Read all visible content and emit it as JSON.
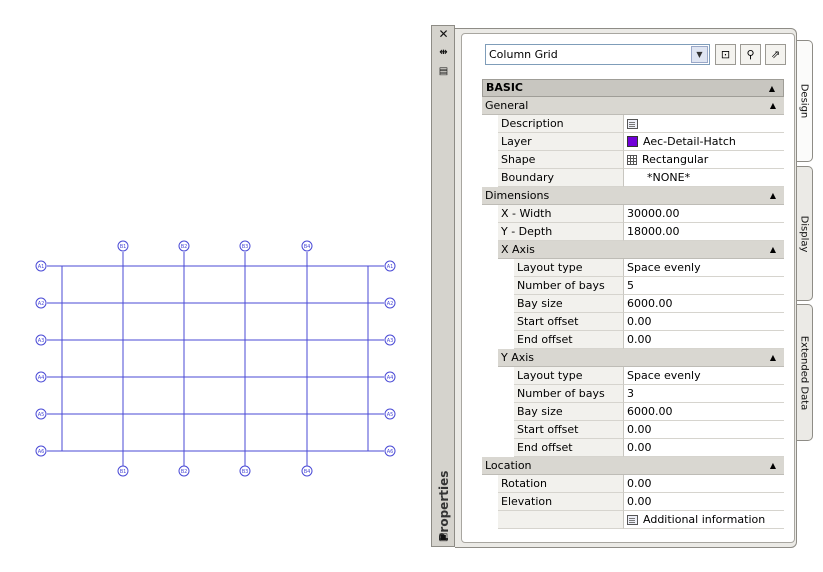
{
  "drawing": {
    "top_labels": [
      "B1",
      "B2",
      "B3",
      "B4"
    ],
    "bottom_labels": [
      "B1",
      "B2",
      "B3",
      "B4"
    ],
    "left_labels": [
      "A1",
      "A2",
      "A3",
      "A4",
      "A5",
      "A6"
    ],
    "right_labels": [
      "A1",
      "A2",
      "A3",
      "A4",
      "A5",
      "A6"
    ],
    "line_color": "#4a4ad6"
  },
  "palette": {
    "title": "Properties",
    "close_icon": "close-icon",
    "tabs": [
      "Design",
      "Display",
      "Extended Data"
    ],
    "style_select": "Column Grid",
    "basic_header": "BASIC",
    "general_header": "General",
    "general": [
      {
        "label": "Description",
        "value": ""
      },
      {
        "label": "Layer",
        "value": "Aec-Detail-Hatch"
      },
      {
        "label": "Shape",
        "value": "Rectangular"
      },
      {
        "label": "Boundary",
        "value": "*NONE*"
      }
    ],
    "dimensions_header": "Dimensions",
    "dimensions": [
      {
        "label": "X - Width",
        "value": "30000.00"
      },
      {
        "label": "Y - Depth",
        "value": "18000.00"
      }
    ],
    "x_axis_header": "X Axis",
    "x_axis": [
      {
        "label": "Layout type",
        "value": "Space evenly"
      },
      {
        "label": "Number of bays",
        "value": "5"
      },
      {
        "label": "Bay size",
        "value": "6000.00"
      },
      {
        "label": "Start offset",
        "value": "0.00"
      },
      {
        "label": "End offset",
        "value": "0.00"
      }
    ],
    "y_axis_header": "Y Axis",
    "y_axis": [
      {
        "label": "Layout type",
        "value": "Space evenly"
      },
      {
        "label": "Number of bays",
        "value": "3"
      },
      {
        "label": "Bay size",
        "value": "6000.00"
      },
      {
        "label": "Start offset",
        "value": "0.00"
      },
      {
        "label": "End offset",
        "value": "0.00"
      }
    ],
    "location_header": "Location",
    "location": [
      {
        "label": "Rotation",
        "value": "0.00"
      },
      {
        "label": "Elevation",
        "value": "0.00"
      },
      {
        "label": "",
        "value": "Additional information"
      }
    ],
    "layer_color": "#7000d8"
  }
}
